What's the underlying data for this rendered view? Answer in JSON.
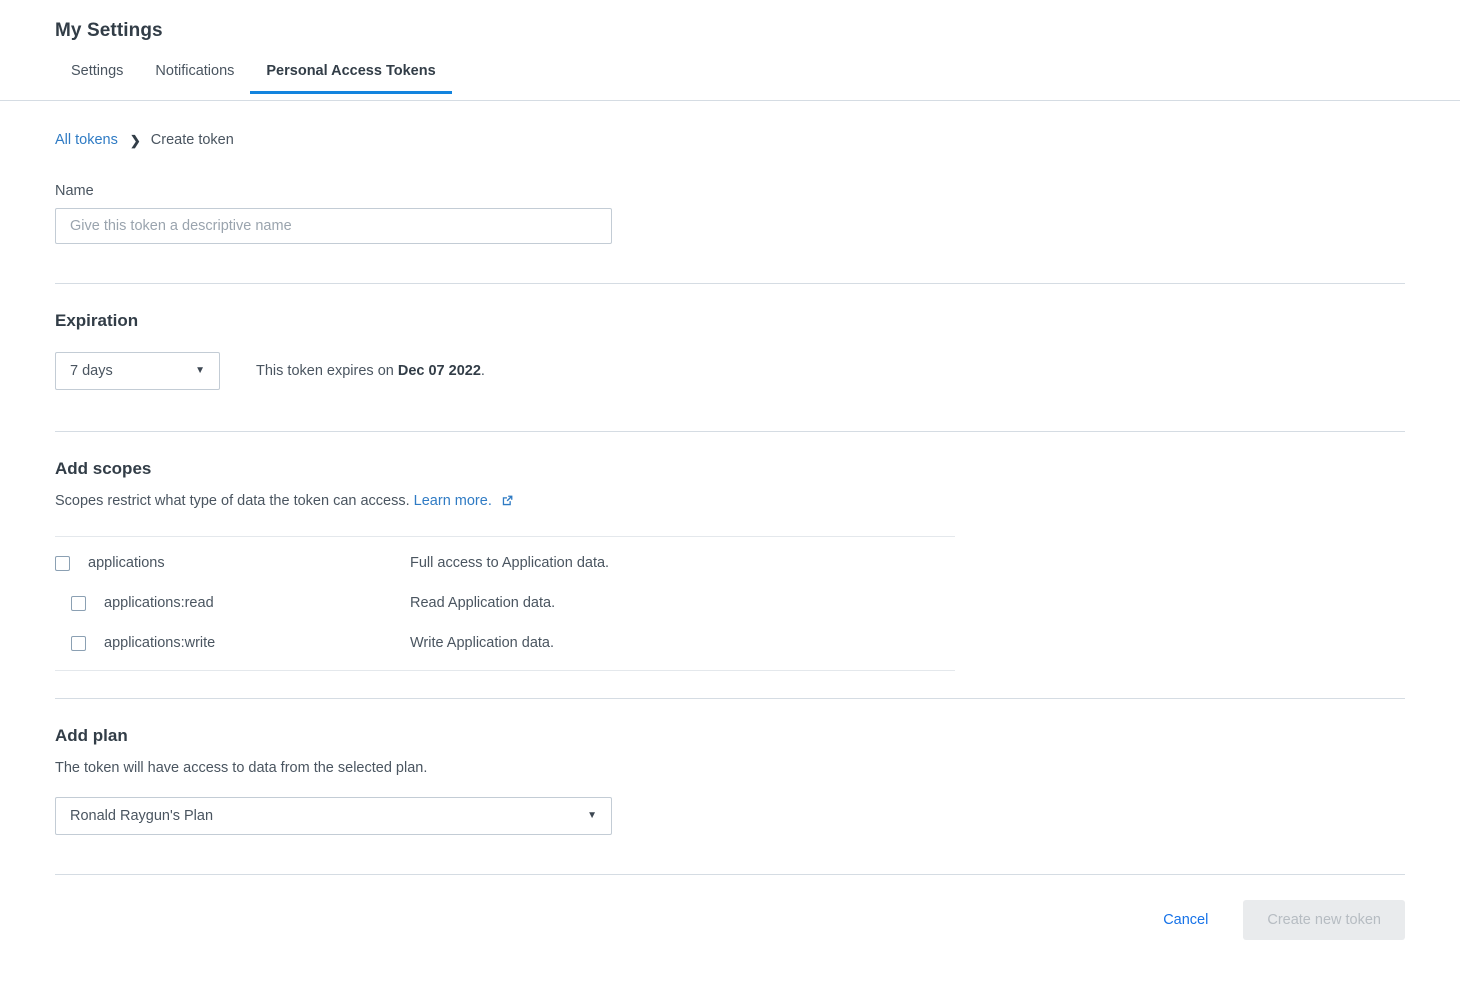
{
  "header": {
    "title": "My Settings",
    "tabs": [
      {
        "label": "Settings",
        "active": false
      },
      {
        "label": "Notifications",
        "active": false
      },
      {
        "label": "Personal Access Tokens",
        "active": true
      }
    ]
  },
  "breadcrumb": {
    "root_label": "All tokens",
    "separator": "❯",
    "current_label": "Create token"
  },
  "name_section": {
    "label": "Name",
    "placeholder": "Give this token a descriptive name",
    "value": ""
  },
  "expiration_section": {
    "title": "Expiration",
    "selected": "7 days",
    "caret": "▼",
    "note_prefix": "This token expires on ",
    "note_date": "Dec 07 2022",
    "note_suffix": "."
  },
  "scopes_section": {
    "title": "Add scopes",
    "description": "Scopes restrict what type of data the token can access.",
    "learn_more_label": "Learn more.",
    "external_icon": "external-link-icon",
    "rows": [
      {
        "name": "applications",
        "description": "Full access to Application data.",
        "checked": false,
        "indented": false
      },
      {
        "name": "applications:read",
        "description": "Read Application data.",
        "checked": false,
        "indented": true
      },
      {
        "name": "applications:write",
        "description": "Write Application data.",
        "checked": false,
        "indented": true
      }
    ]
  },
  "plan_section": {
    "title": "Add plan",
    "description": "The token will have access to data from the selected plan.",
    "selected": "Ronald Raygun's Plan",
    "caret": "▼"
  },
  "footer": {
    "cancel_label": "Cancel",
    "submit_label": "Create new token",
    "submit_disabled": true
  },
  "colors": {
    "accent_blue": "#1384de",
    "link_blue": "#2f7bc4",
    "cancel_blue": "#1672e8",
    "heading": "#323d47",
    "text": "#4a5560",
    "border": "#c3ccd5",
    "divider": "#d5dce3",
    "disabled_bg": "#e9ebed",
    "disabled_text": "#b6bcc2"
  }
}
